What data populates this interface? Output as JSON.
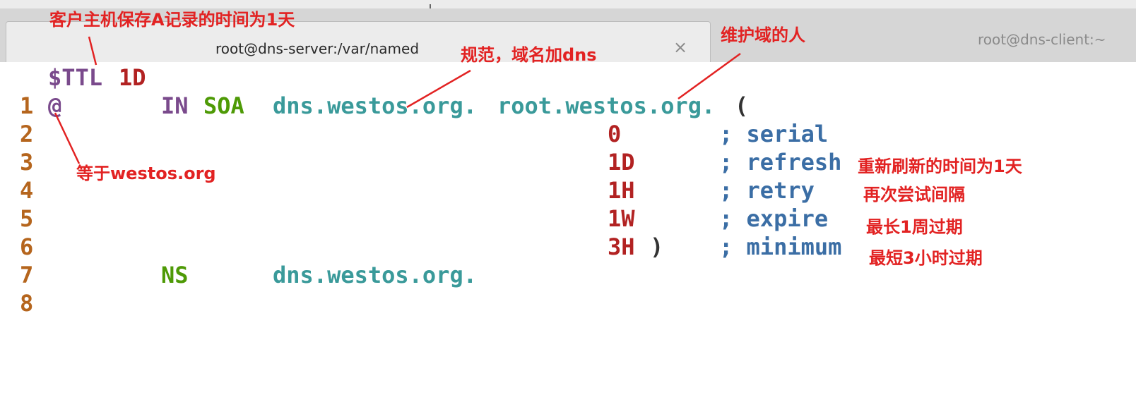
{
  "window": {
    "tabs": [
      {
        "title": "root@dns-server:/var/named",
        "active": true
      },
      {
        "title": "root@dns-client:~",
        "active": false
      }
    ]
  },
  "editor": {
    "lines": [
      {
        "num": "1",
        "tokens": [
          "$TTL",
          "1D"
        ]
      },
      {
        "num": "2",
        "tokens": [
          "@",
          "IN",
          "SOA",
          "dns.westos.org.",
          "root.westos.org.",
          "("
        ]
      },
      {
        "num": "3",
        "tokens": [
          "0",
          "; serial"
        ]
      },
      {
        "num": "4",
        "tokens": [
          "1D",
          "; refresh"
        ]
      },
      {
        "num": "5",
        "tokens": [
          "1H",
          "; retry"
        ]
      },
      {
        "num": "6",
        "tokens": [
          "1W",
          "; expire"
        ]
      },
      {
        "num": "7",
        "tokens": [
          "3H",
          ")",
          "; minimum"
        ]
      },
      {
        "num": "8",
        "tokens": [
          "NS",
          "dns.westos.org."
        ]
      }
    ]
  },
  "annotations": {
    "ttl": "客户主机保存A记录的时间为1天",
    "domain_dot": "规范，域名加dns",
    "admin": "维护域的人",
    "at": "等于westos.org",
    "refresh": "重新刷新的时间为1天",
    "retry": "再次尝试间隔",
    "expire": "最长1周过期",
    "minimum": "最短3小时过期"
  },
  "colors": {
    "annotation": "#e22222",
    "line_number": "#b5651d",
    "keyword_purple": "#7a4a8c",
    "value_red": "#b22222",
    "type_green": "#4e9a06",
    "name_teal": "#3a9a9a",
    "comment_blue": "#3b6ea5",
    "tab_underline": "#5aa0e6"
  },
  "icons": {
    "tab_close": "close-icon"
  }
}
